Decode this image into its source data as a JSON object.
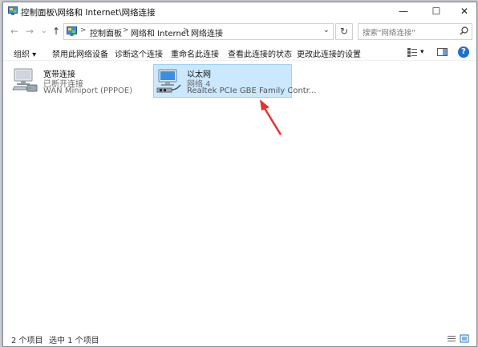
{
  "window": {
    "title": "控制面板\\网络和 Internet\\网络连接",
    "minimize_glyph": "—",
    "maximize_glyph": "☐",
    "close_glyph": "✕"
  },
  "nav": {
    "back_glyph": "←",
    "forward_glyph": "→",
    "history_glyph": "⌄",
    "up_glyph": "↑",
    "breadcrumbs": [
      "控制面板",
      "网络和 Internet",
      "网络连接"
    ],
    "separator": ">",
    "dropdown_glyph": "⌄",
    "refresh_glyph": "↻",
    "search_placeholder": "搜索\"网络连接\""
  },
  "commands": {
    "organize": "组织 ▾",
    "disable": "禁用此网络设备",
    "diagnose": "诊断这个连接",
    "rename": "重命名此连接",
    "view_status": "查看此连接的状态",
    "change_settings": "更改此连接的设置",
    "view_dropdown_glyph": "▾",
    "help_glyph": "?"
  },
  "connections": [
    {
      "name": "宽带连接",
      "status": "已断开连接",
      "device": "WAN Miniport (PPPOE)",
      "icon": "dialup-connection-icon",
      "selected": false
    },
    {
      "name": "以太网",
      "status": "网络 4",
      "device": "Realtek PCIe GBE Family Contr...",
      "icon": "ethernet-connection-icon",
      "selected": true
    }
  ],
  "statusbar": {
    "count": "2 个项目",
    "selected": "选中 1 个项目"
  },
  "colors": {
    "selection_bg": "#cce8ff",
    "selection_border": "#99d1ff",
    "annotation_arrow": "#e8322c",
    "help_blue": "#1e6fd0"
  }
}
